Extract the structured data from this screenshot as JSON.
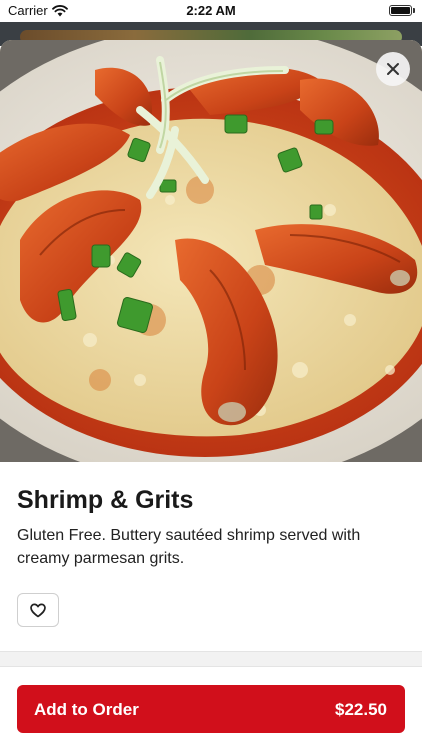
{
  "status_bar": {
    "carrier": "Carrier",
    "time": "2:22 AM",
    "icons": [
      "wifi-icon",
      "battery-icon"
    ]
  },
  "item": {
    "title": "Shrimp & Grits",
    "description": "Gluten Free. Buttery sautéed shrimp served with creamy parmesan grits.",
    "image": "shrimp-and-grits-photo"
  },
  "actions": {
    "close_icon": "close-icon",
    "favorite_icon": "heart-icon",
    "add_to_order_label": "Add to Order",
    "price": "$22.50"
  },
  "colors": {
    "accent": "#d10f1b",
    "background": "#ffffff",
    "text": "#1a1a1a"
  }
}
